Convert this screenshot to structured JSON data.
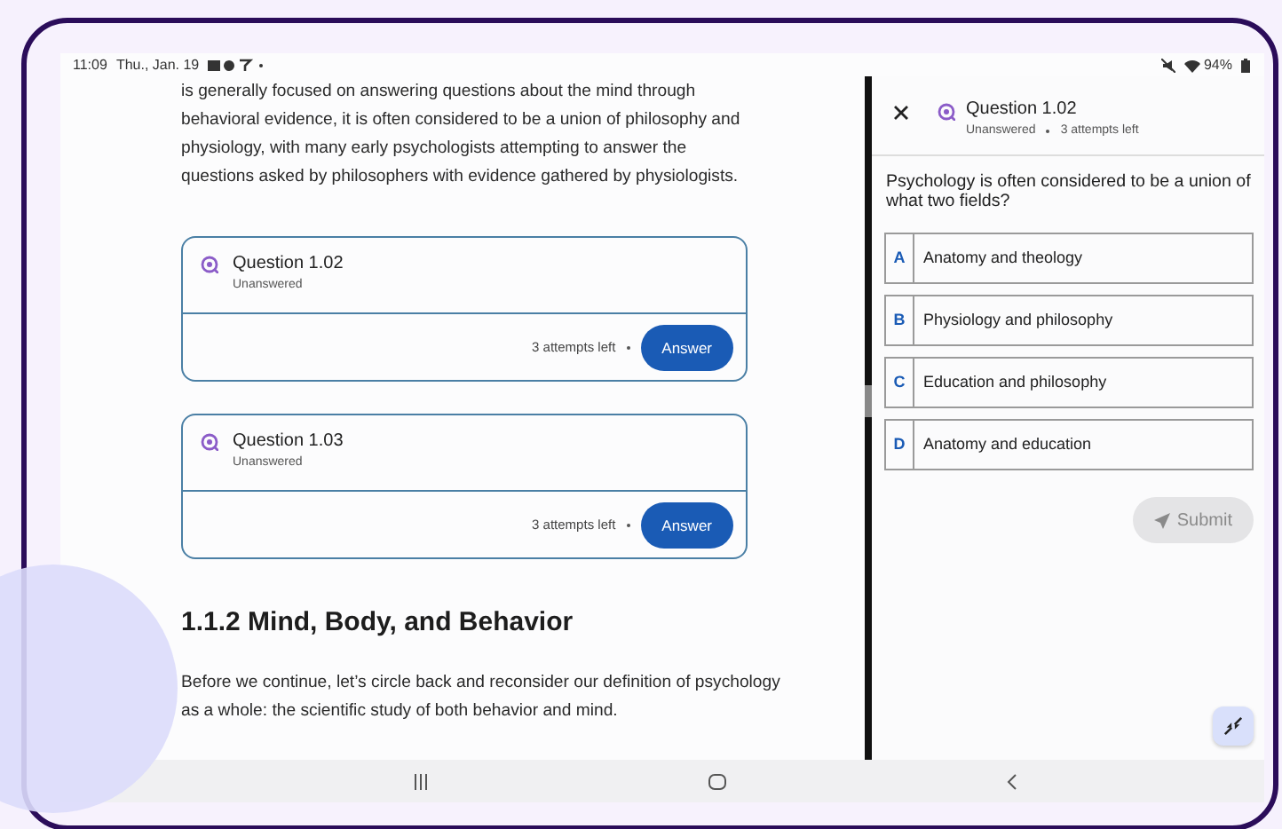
{
  "status_bar": {
    "time": "11:09",
    "date": "Thu., Jan. 19",
    "battery": "94%"
  },
  "article": {
    "intro": "is generally focused on answering questions about the mind through behavioral evidence, it is often considered to be a union of philosophy and physiology, with many early psychologists attempting to answer the questions asked by philosophers with evidence gathered by physiologists.",
    "question_cards": [
      {
        "title": "Question 1.02",
        "status": "Unanswered",
        "attempts": "3 attempts left",
        "button": "Answer"
      },
      {
        "title": "Question 1.03",
        "status": "Unanswered",
        "attempts": "3 attempts left",
        "button": "Answer"
      }
    ],
    "heading": "1.1.2 Mind, Body, and Behavior",
    "body": "Before we continue, let’s circle back and reconsider our definition of psychology as a whole: the scientific study of both behavior and mind."
  },
  "panel": {
    "title": "Question 1.02",
    "status": "Unanswered",
    "attempts": "3 attempts left",
    "question": "Psychology is often considered to be a union of what two fields?",
    "options": [
      {
        "letter": "A",
        "text": "Anatomy and theology",
        "selected": false
      },
      {
        "letter": "B",
        "text": "Physiology and philosophy",
        "selected": false
      },
      {
        "letter": "C",
        "text": "Education and philosophy",
        "selected": false
      },
      {
        "letter": "D",
        "text": "Anatomy and education",
        "selected": false
      }
    ],
    "submit": {
      "label": "Submit",
      "disabled": true
    }
  }
}
